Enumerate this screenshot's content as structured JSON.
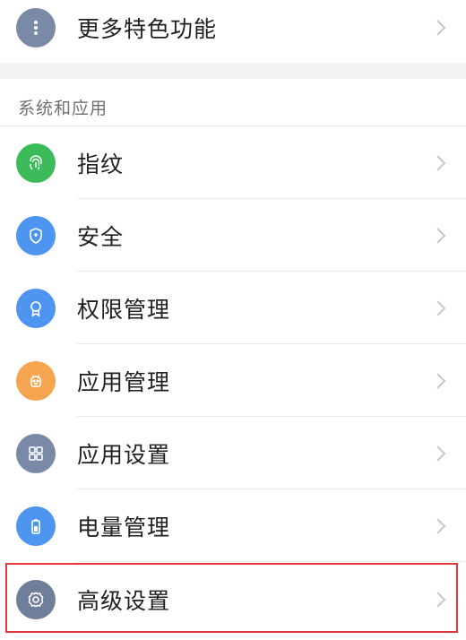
{
  "top_item": {
    "label": "更多特色功能",
    "icon": "more-dots-icon",
    "color": "#7a8aa6"
  },
  "section": {
    "header": "系统和应用"
  },
  "items": [
    {
      "label": "指纹",
      "icon": "fingerprint-icon",
      "color": "#3dbb5b"
    },
    {
      "label": "安全",
      "icon": "shield-icon",
      "color": "#4e95f2"
    },
    {
      "label": "权限管理",
      "icon": "badge-icon",
      "color": "#4e95f2"
    },
    {
      "label": "应用管理",
      "icon": "android-icon",
      "color": "#f5a450"
    },
    {
      "label": "应用设置",
      "icon": "grid-icon",
      "color": "#7a8aa6"
    },
    {
      "label": "电量管理",
      "icon": "battery-icon",
      "color": "#4e95f2"
    },
    {
      "label": "高级设置",
      "icon": "gear-icon",
      "color": "#6f7f9a"
    }
  ],
  "highlight_color": "#e0393e"
}
